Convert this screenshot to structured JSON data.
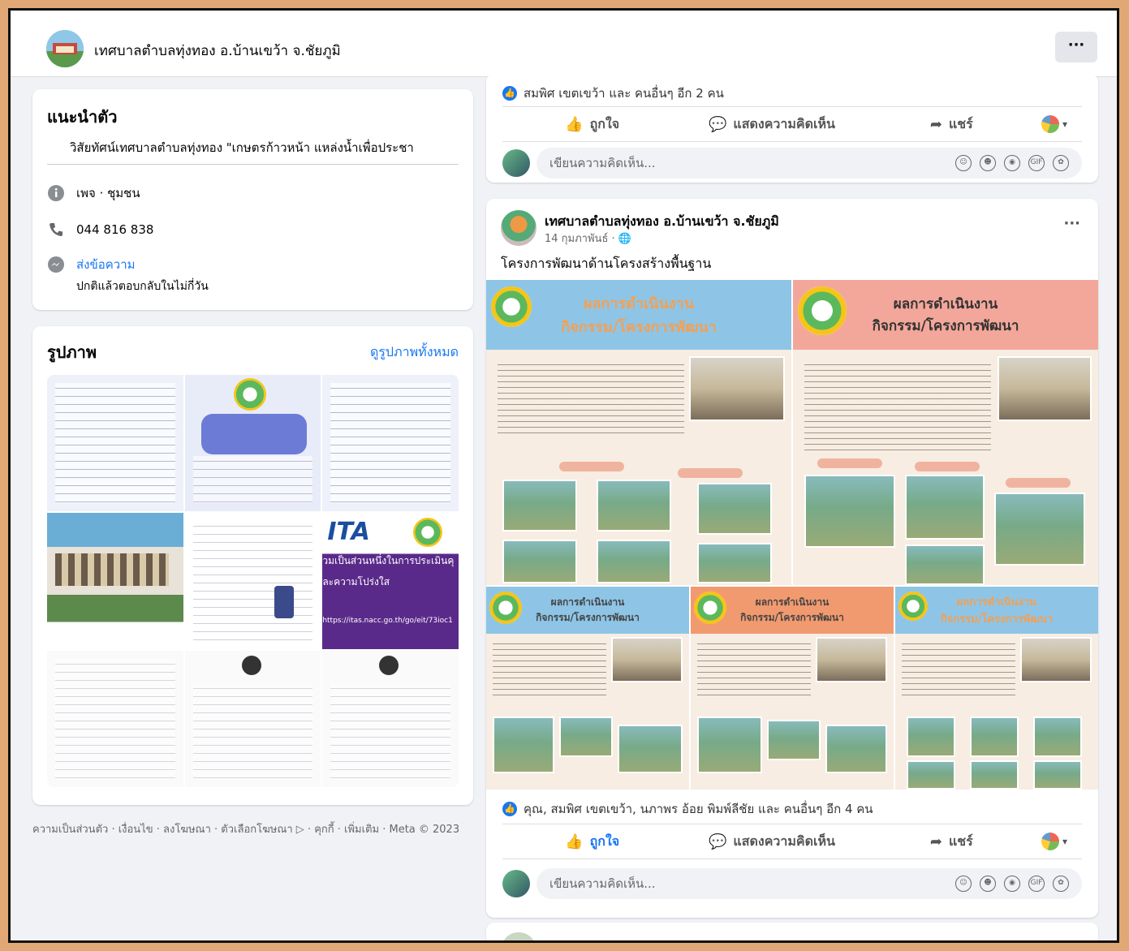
{
  "header": {
    "page_name": "เทศบาลตำบลทุ่งทอง อ.บ้านเขว้า จ.ชัยภูมิ",
    "more_label": "···"
  },
  "intro": {
    "title": "แนะนำตัว",
    "vision": "วิสัยทัศน์เทศบาลตำบลทุ่งทอง \"เกษตรก้าวหน้า แหล่งน้ำเพื่อประชา",
    "category": "เพจ · ชุมชน",
    "phone": "044 816 838",
    "message_label": "ส่งข้อความ",
    "reply_note": "ปกติแล้วตอบกลับในไม่กี่วัน"
  },
  "photos": {
    "title": "รูปภาพ",
    "see_all": "ดูรูปภาพทั้งหมด",
    "ita_label": "ITA",
    "ita_line1": "วมเป็นส่วนหนึ่งในการประเมินคุ",
    "ita_line2": "ละความโปร่งใส",
    "ita_url": "https://itas.nacc.go.th/go/eit/73ioc1"
  },
  "footer": "ความเป็นส่วนตัว · เงื่อนไข · ลงโฆษณา · ตัวเลือกโฆษณา ▷ · คุกกี้ · เพิ่มเติม · Meta © 2023",
  "post1": {
    "reactions": "สมพิศ เขตเขว้า และ คนอื่นๆ อีก 2 คน",
    "like": "ถูกใจ",
    "comment": "แสดงความคิดเห็น",
    "share": "แชร์",
    "comment_placeholder": "เขียนความคิดเห็น..."
  },
  "post2": {
    "author": "เทศบาลตำบลทุ่งทอง อ.บ้านเขว้า จ.ชัยภูมิ",
    "date": "14 กุมภาพันธ์ · ",
    "text": "โครงการพัฒนาด้านโครงสร้างพื้นฐาน",
    "banner_line1": "ผลการดำเนินงาน",
    "banner_line2": "กิจกรรม/โครงการพัฒนา",
    "reactions": "คุณ, สมพิศ เขตเขว้า, นภาพร อ้อย พิมพ์ลีชัย และ คนอื่นๆ อีก 4 คน",
    "like": "ถูกใจ",
    "comment": "แสดงความคิดเห็น",
    "share": "แชร์",
    "comment_placeholder": "เขียนความคิดเห็น..."
  },
  "colors": {
    "accent": "#1877f2",
    "banner_blue": "#8ec5e6",
    "banner_pink": "#f3a79a",
    "banner_orange": "#f29a6f"
  }
}
